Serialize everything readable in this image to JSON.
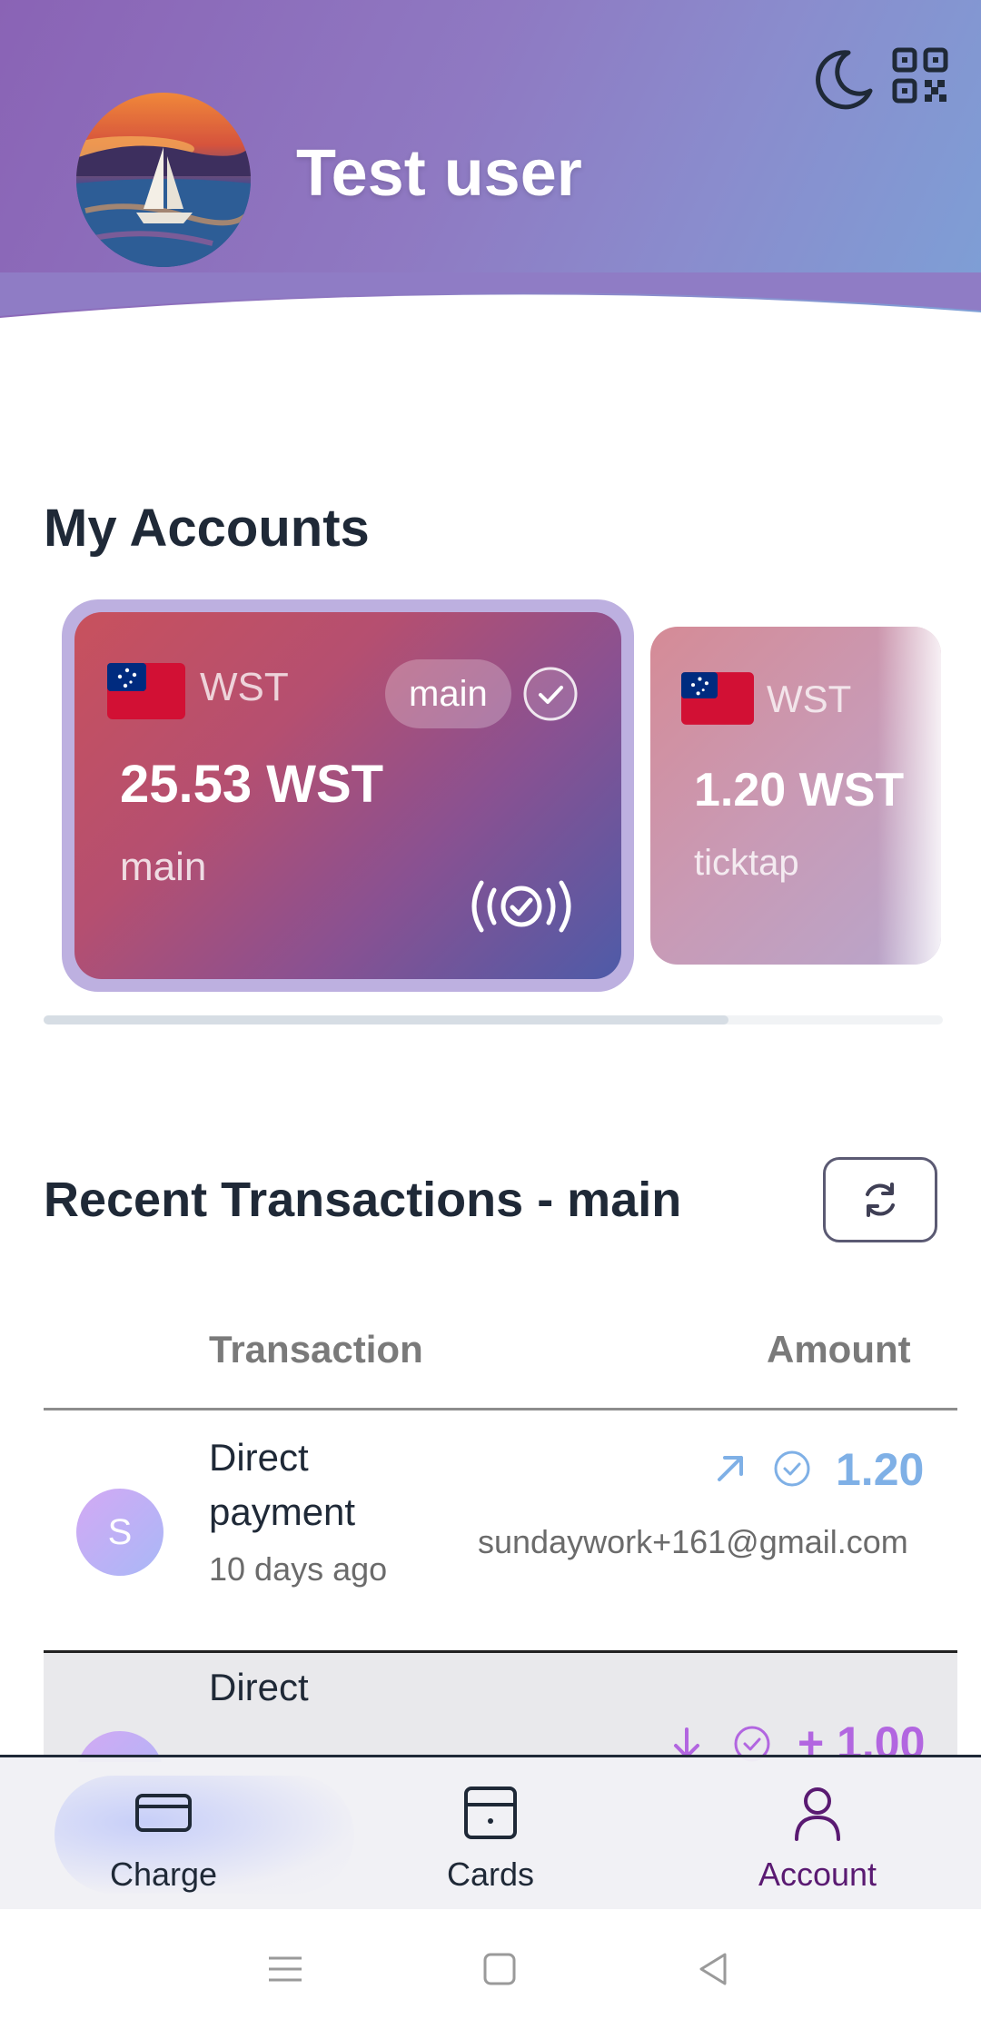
{
  "header": {
    "user_name": "Test user",
    "icons": [
      "moon-icon",
      "qr-code-icon"
    ]
  },
  "accounts": {
    "title": "My Accounts",
    "cards": [
      {
        "currency": "WST",
        "balance": "25.53 WST",
        "name": "main",
        "badge": "main",
        "selected": true
      },
      {
        "currency": "WST",
        "balance": "1.20 WST",
        "name": "ticktap",
        "selected": false
      }
    ]
  },
  "transactions": {
    "title": "Recent Transactions - main",
    "columns": {
      "transaction": "Transaction",
      "amount": "Amount"
    },
    "rows": [
      {
        "avatar": "S",
        "title_line1": "Direct",
        "title_line2": "payment",
        "time": "10 days ago",
        "amount": "1.20",
        "email": "sundaywork+161@gmail.com",
        "direction": "outgoing",
        "color": "#7fb0e6"
      },
      {
        "avatar": "",
        "title_line1": "Direct",
        "amount": "+ 1.00",
        "direction": "incoming",
        "color": "#b266e0"
      }
    ]
  },
  "nav": {
    "items": [
      {
        "label": "Charge",
        "icon": "credit-card-icon",
        "active": false
      },
      {
        "label": "Cards",
        "icon": "card-wallet-icon",
        "active": false
      },
      {
        "label": "Account",
        "icon": "user-icon",
        "active": true
      }
    ]
  },
  "colors": {
    "header_start": "#8a63b5",
    "header_end": "#7da0d6",
    "active_nav": "#5a1a72",
    "outgoing": "#7fb0e6",
    "incoming": "#b266e0"
  }
}
